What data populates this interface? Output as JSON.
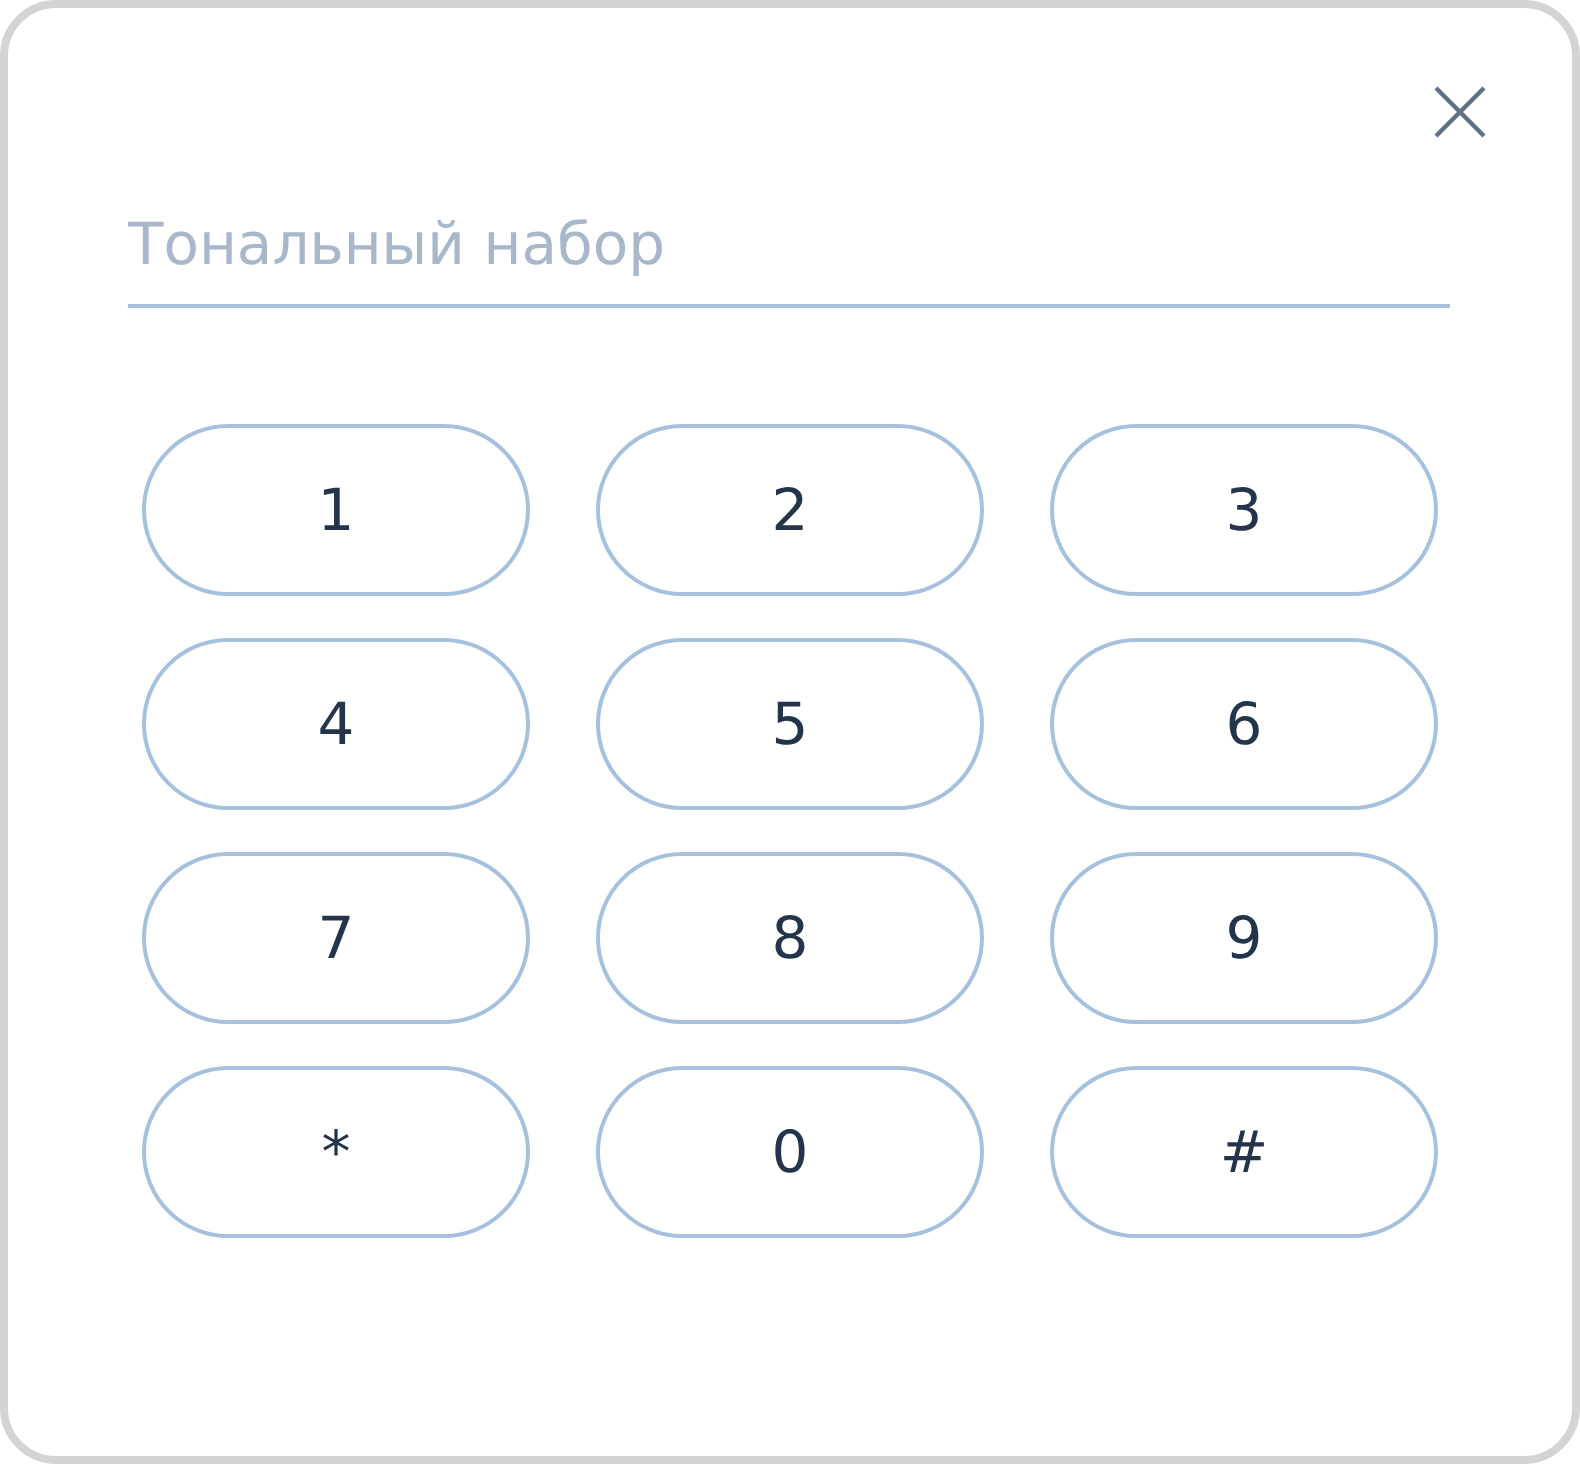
{
  "dialog": {
    "field": {
      "placeholder": "Тональный набор"
    },
    "keys": [
      {
        "label": "1"
      },
      {
        "label": "2"
      },
      {
        "label": "3"
      },
      {
        "label": "4"
      },
      {
        "label": "5"
      },
      {
        "label": "6"
      },
      {
        "label": "7"
      },
      {
        "label": "8"
      },
      {
        "label": "9"
      },
      {
        "label": "*"
      },
      {
        "label": "0"
      },
      {
        "label": "#"
      }
    ]
  }
}
